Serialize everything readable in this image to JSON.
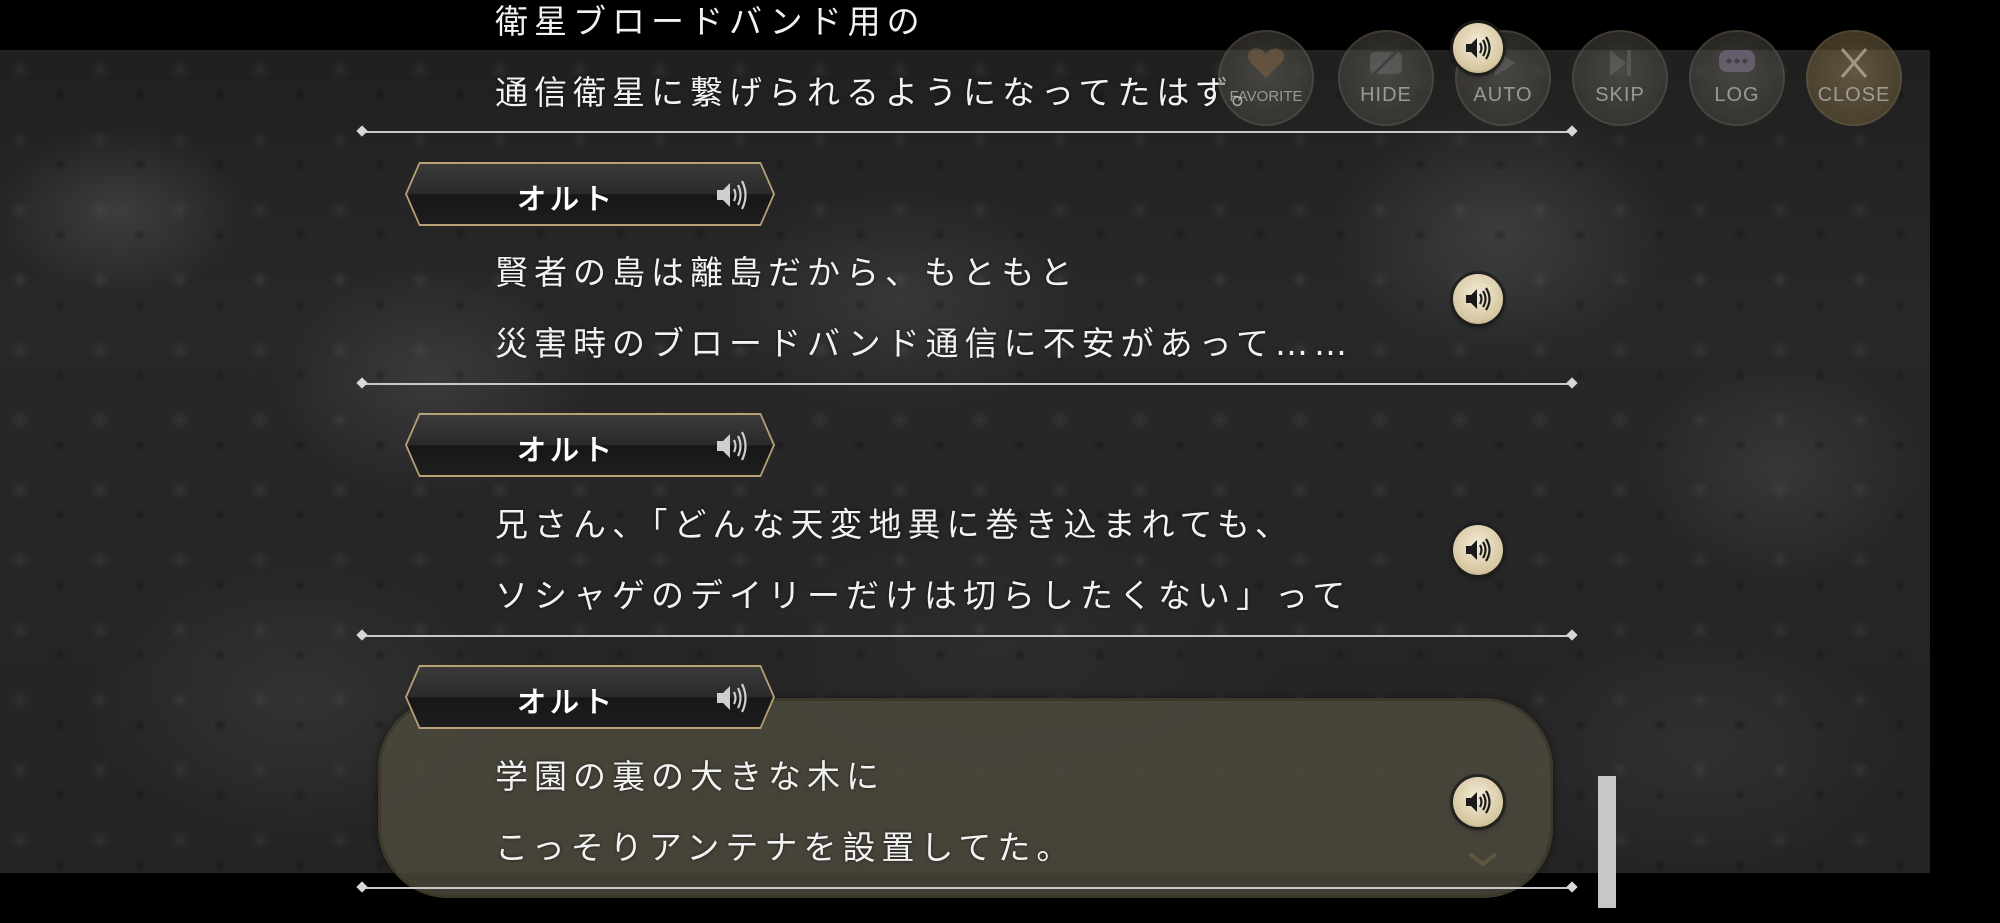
{
  "menu": {
    "favorite": "FAVORITE",
    "hide": "HIDE",
    "auto": "AUTO",
    "skip": "SKIP",
    "log": "LOG",
    "close": "CLOSE"
  },
  "log": {
    "partial_line": "衛星ブロードバンド用の",
    "entries": [
      {
        "lines": [
          "通信衛星に繋げられるようになってたはず。"
        ]
      },
      {
        "speaker": "オルト",
        "lines": [
          "賢者の島は離島だから、もともと",
          "災害時のブロードバンド通信に不安があって……"
        ]
      },
      {
        "speaker": "オルト",
        "lines": [
          "兄さん、「どんな天変地異に巻き込まれても、",
          "ソシャゲのデイリーだけは切らしたくない」って"
        ]
      },
      {
        "speaker": "オルト",
        "lines": [
          "学園の裏の大きな木に",
          "こっそりアンテナを設置してた。"
        ]
      }
    ]
  },
  "icons": {
    "speaker": "speaker-icon",
    "voice_play": "voice-play-icon",
    "scroll_down": "chevron-down-icon"
  },
  "colors": {
    "nameplate_border": "#b8a275",
    "voice_button": "#e6dbc0",
    "current_box": "#4e4a3e"
  }
}
